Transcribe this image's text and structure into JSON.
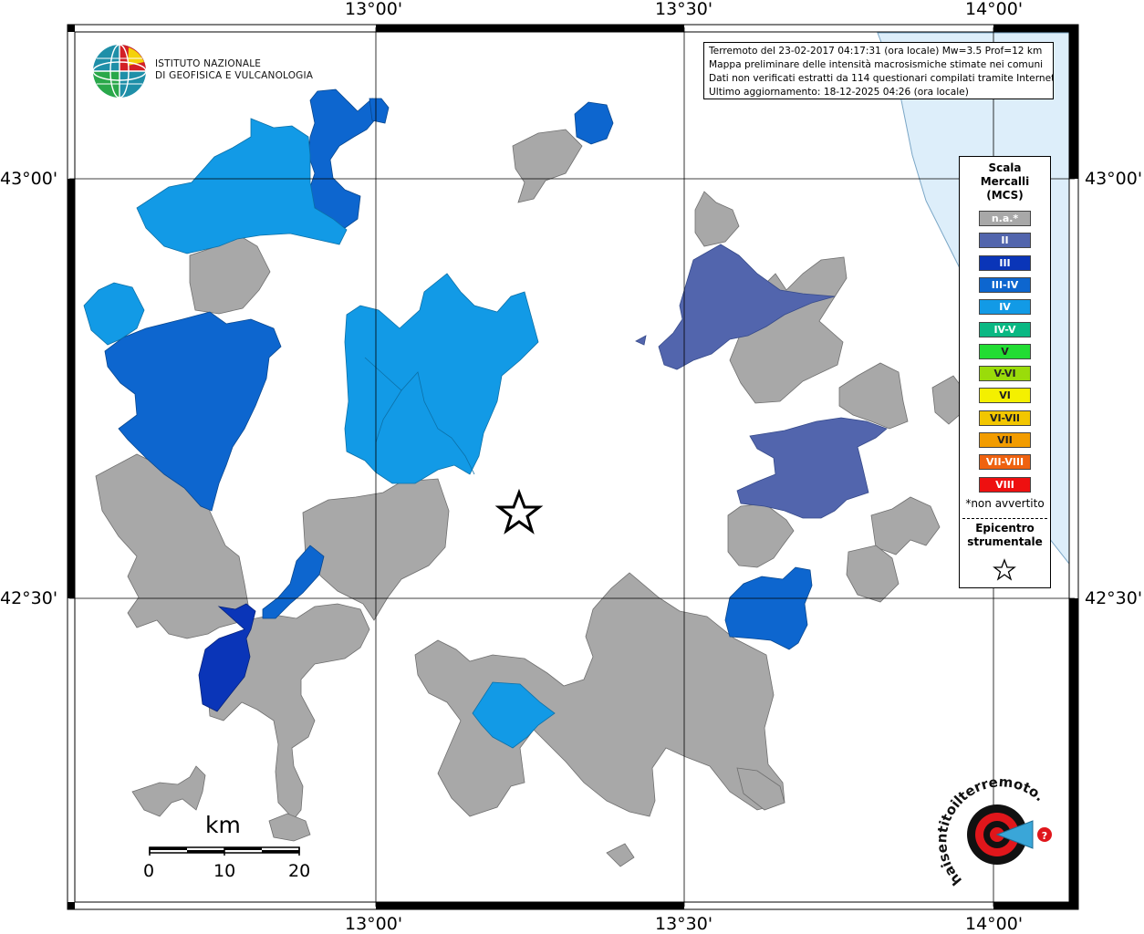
{
  "map": {
    "lat_labels": [
      "43°00'",
      "42°30'"
    ],
    "lon_labels": [
      "13°00'",
      "13°30'",
      "14°00'"
    ]
  },
  "logo": {
    "line1": "ISTITUTO NAZIONALE",
    "line2": "DI GEOFISICA E VULCANOLOGIA",
    "icon": "ingv-globe-icon"
  },
  "info": {
    "line1": "Terremoto del 23-02-2017 04:17:31 (ora locale) Mw=3.5 Prof=12 km",
    "line2": "Mappa preliminare delle intensità macrosismiche stimate nei comuni",
    "line3": "Dati non verificati estratti da 114 questionari compilati tramite Internet.",
    "line4": "Ultimo aggiornamento: 18-12-2025 04:26 (ora locale)"
  },
  "legend": {
    "title1": "Scala",
    "title2": "Mercalli",
    "title3": "(MCS)",
    "items": [
      {
        "label": "n.a.*",
        "color": "#a8a8a8"
      },
      {
        "label": "II",
        "color": "#5265ad"
      },
      {
        "label": "III",
        "color": "#0a35b8"
      },
      {
        "label": "III-IV",
        "color": "#0d66cf"
      },
      {
        "label": "IV",
        "color": "#129ae6"
      },
      {
        "label": "IV-V",
        "color": "#0ab883"
      },
      {
        "label": "V",
        "color": "#22dd33"
      },
      {
        "label": "V-VI",
        "color": "#9adc0a"
      },
      {
        "label": "VI",
        "color": "#f4f000"
      },
      {
        "label": "VI-VII",
        "color": "#f2c600"
      },
      {
        "label": "VII",
        "color": "#f29c00"
      },
      {
        "label": "VII-VIII",
        "color": "#ef6210"
      },
      {
        "label": "VIII",
        "color": "#ee1010"
      }
    ],
    "note": "*non avvertito",
    "epicenter1": "Epicentro",
    "epicenter2": "strumentale",
    "epicenter_icon": "star-outline-icon"
  },
  "scale_bar": {
    "title": "km",
    "labels": [
      "0",
      "10",
      "20"
    ]
  },
  "watermark": {
    "text": "haisentitoilterremoto.it",
    "icon": "haisentito-logo-icon"
  },
  "colors": {
    "na": "#a8a8a8",
    "ii": "#5265ad",
    "iii": "#0a35b8",
    "iii_iv": "#0d66cf",
    "iv": "#129ae6",
    "sea": "#ddeefa"
  }
}
